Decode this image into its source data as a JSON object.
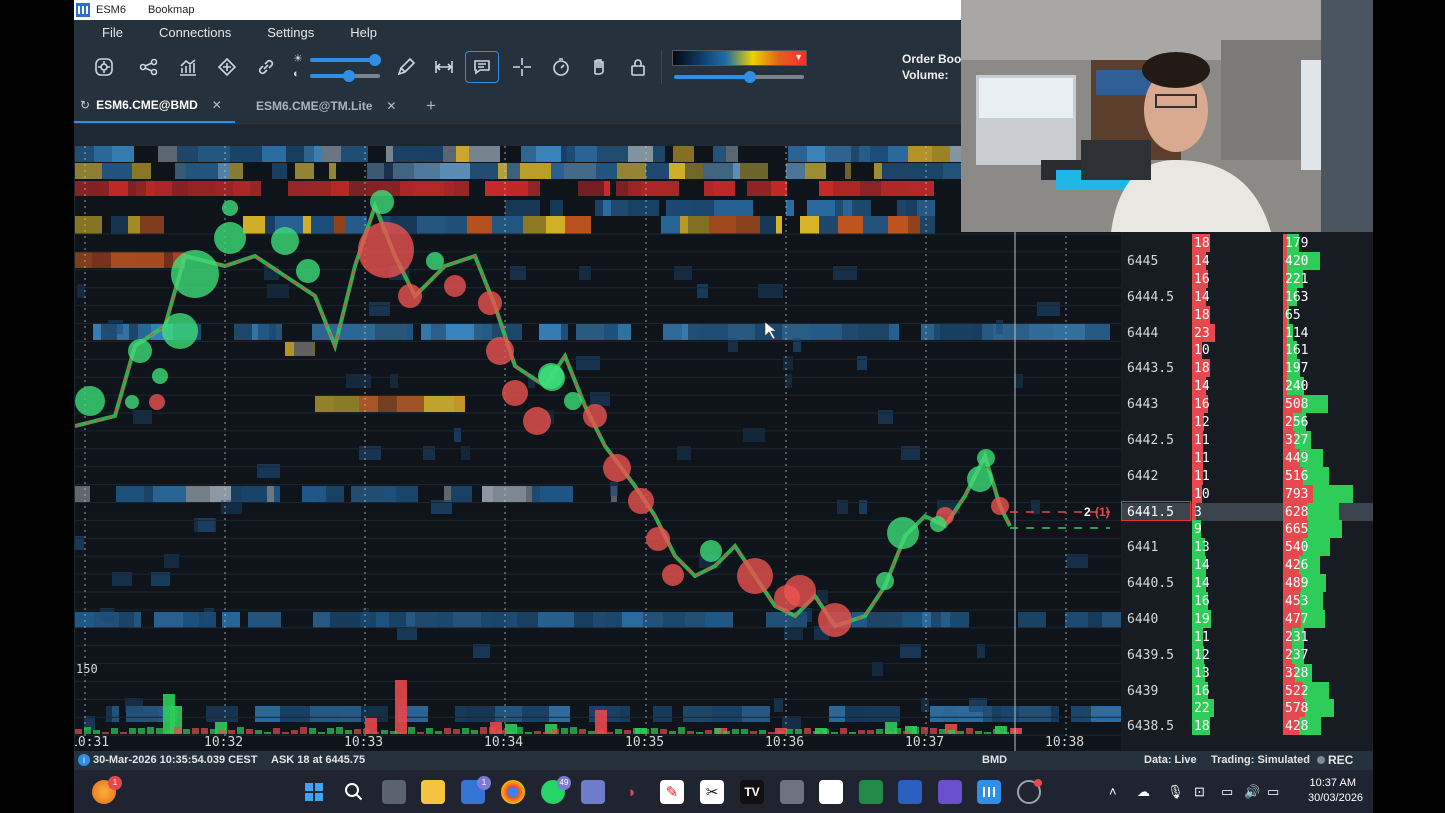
{
  "window": {
    "title": "ESM6",
    "app": "Bookmap"
  },
  "menu": [
    "File",
    "Connections",
    "Settings",
    "Help"
  ],
  "toolbar": {
    "icons": [
      "target-icon",
      "share-nodes-icon",
      "chart-icon",
      "diamond-icon",
      "link-icon",
      "pencil-icon",
      "range-icon",
      "comment-icon",
      "crosshair-icon",
      "timer-icon",
      "hand-icon",
      "lock-icon"
    ],
    "brightness_level": 0.9,
    "contrast_level": 0.5,
    "gradient_level": 0.58,
    "order_book_label": "Order Boo",
    "volume_label": "Volume:"
  },
  "tabs": [
    {
      "label": "ESM6.CME@BMD",
      "active": true
    },
    {
      "label": "ESM6.CME@TM.Lite",
      "active": false
    }
  ],
  "add_tab": "+",
  "chart": {
    "price_labels": [
      "6445",
      "6444.5",
      "6444",
      "6443.5",
      "6443",
      "6442.5",
      "6442",
      "6441.5",
      "6441",
      "6440.5",
      "6440",
      "6439.5",
      "6439",
      "6438.5"
    ],
    "time_labels": [
      "10:31",
      "10:32",
      "10:33",
      "10:34",
      "10:35",
      "10:36",
      "10:37",
      "10:38"
    ],
    "volume_scale_label": "150",
    "position_label": "2",
    "position_count": "(1)"
  },
  "order_book": {
    "current_price": "6441.5",
    "rows": [
      {
        "bid": "18",
        "ask": "179"
      },
      {
        "price": "6445",
        "bid": "14",
        "ask": "420"
      },
      {
        "bid": "16",
        "ask": "221"
      },
      {
        "price": "6444.5",
        "bid": "14",
        "ask": "163"
      },
      {
        "bid": "18",
        "ask": "65"
      },
      {
        "price": "6444",
        "bid": "23",
        "ask": "114"
      },
      {
        "bid": "10",
        "ask": "161"
      },
      {
        "price": "6443.5",
        "bid": "18",
        "ask": "197"
      },
      {
        "bid": "14",
        "ask": "240"
      },
      {
        "price": "6443",
        "bid": "16",
        "ask": "508"
      },
      {
        "bid": "12",
        "ask": "256"
      },
      {
        "price": "6442.5",
        "bid": "11",
        "ask": "327"
      },
      {
        "bid": "11",
        "ask": "449"
      },
      {
        "price": "6442",
        "bid": "11",
        "ask": "516"
      },
      {
        "bid": "10",
        "ask": "793"
      },
      {
        "price": "6441.5",
        "bid": "3",
        "ask": "628",
        "current": true
      },
      {
        "bid": "9",
        "ask": "665"
      },
      {
        "price": "6441",
        "bid": "13",
        "ask": "540"
      },
      {
        "bid": "14",
        "ask": "426"
      },
      {
        "price": "6440.5",
        "bid": "14",
        "ask": "489"
      },
      {
        "bid": "16",
        "ask": "453"
      },
      {
        "price": "6440",
        "bid": "19",
        "ask": "477"
      },
      {
        "bid": "11",
        "ask": "231"
      },
      {
        "price": "6439.5",
        "bid": "12",
        "ask": "237"
      },
      {
        "bid": "13",
        "ask": "328"
      },
      {
        "price": "6439",
        "bid": "16",
        "ask": "522"
      },
      {
        "bid": "22",
        "ask": "578"
      },
      {
        "price": "6438.5",
        "bid": "18",
        "ask": "428"
      }
    ]
  },
  "status": {
    "datetime": "30-Mar-2026 10:35:54.039 CEST",
    "ask": "ASK 18 at 6445.75",
    "provider": "BMD",
    "data": "Data: Live",
    "trading": "Trading: Simulated",
    "rec": "REC"
  },
  "taskbar": {
    "time": "10:37 AM",
    "date": "30/03/2026",
    "badges": {
      "store": "1",
      "whatsapp": "49",
      "profile": "1"
    }
  },
  "colors": {
    "accent": "#2f8fe6",
    "bid": "#e5484d",
    "ask": "#2ecc58",
    "panel": "#25313d"
  }
}
